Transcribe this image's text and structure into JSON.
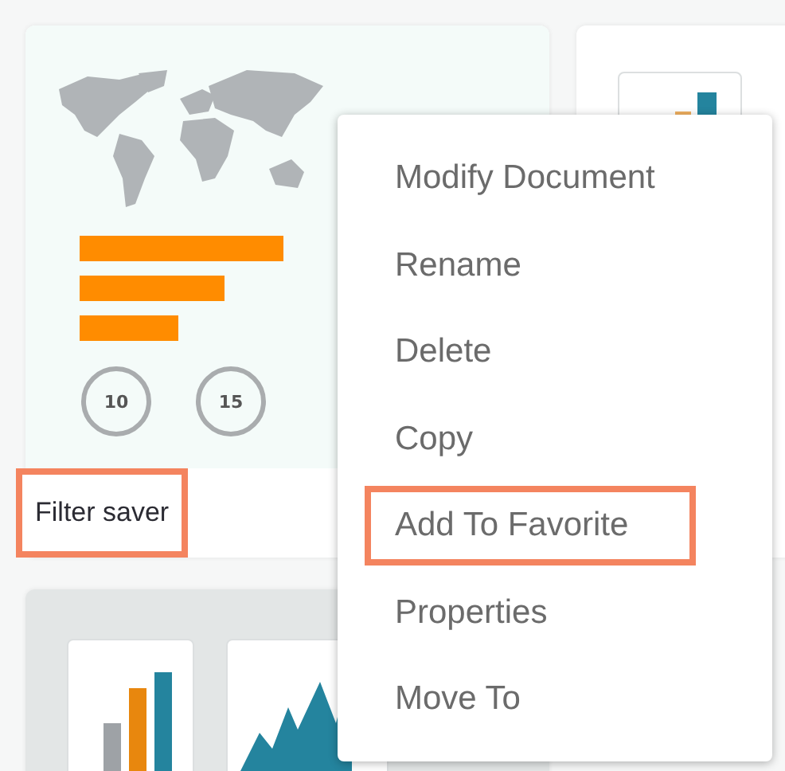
{
  "cards": [
    {
      "kind": "map",
      "title": "Filter saver",
      "highlighted": true,
      "gauges": [
        "10",
        "15"
      ]
    },
    {
      "kind": "chart-tile"
    }
  ],
  "bottom_cards": [
    {
      "kind": "charts"
    }
  ],
  "context_menu": {
    "items": [
      {
        "label": "Modify Document",
        "highlighted": false
      },
      {
        "label": "Rename",
        "highlighted": false
      },
      {
        "label": "Delete",
        "highlighted": false
      },
      {
        "label": "Copy",
        "highlighted": false
      },
      {
        "label": "Add To Favorite",
        "highlighted": true
      },
      {
        "label": "Properties",
        "highlighted": false
      },
      {
        "label": "Move To",
        "highlighted": false
      }
    ]
  }
}
